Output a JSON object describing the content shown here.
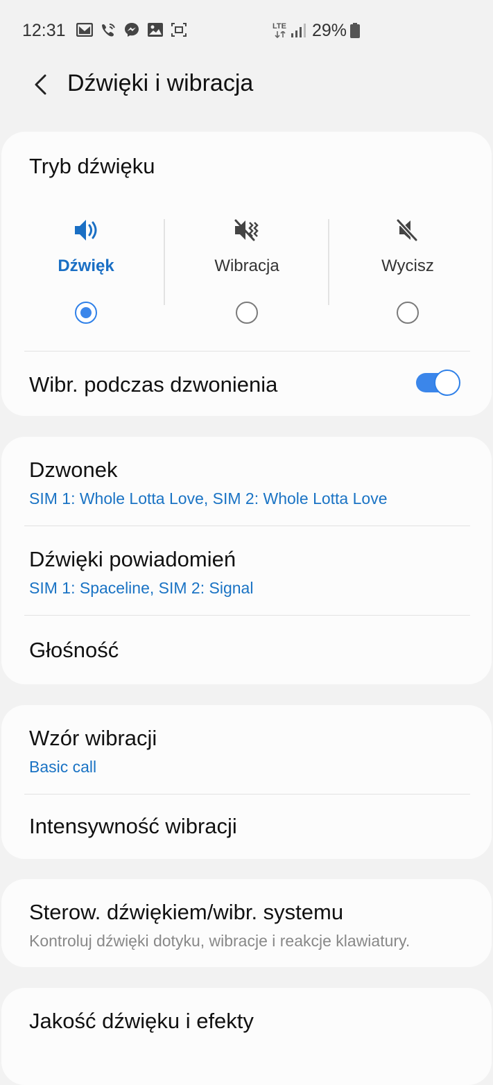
{
  "status_bar": {
    "time": "12:31",
    "network": "LTE",
    "battery_percent": "29%",
    "icons": [
      "gmail-icon",
      "wifi-call-icon",
      "messenger-icon",
      "gallery-icon",
      "screenshot-icon",
      "signal-icon",
      "battery-icon"
    ]
  },
  "header": {
    "title": "Dźwięki i wibracja"
  },
  "sound_mode": {
    "title": "Tryb dźwięku",
    "options": [
      {
        "label": "Dźwięk",
        "selected": true
      },
      {
        "label": "Wibracja",
        "selected": false
      },
      {
        "label": "Wycisz",
        "selected": false
      }
    ],
    "vibrate_while_ringing": {
      "label": "Wibr. podczas dzwonienia",
      "on": true
    }
  },
  "ringtones": {
    "ringtone": {
      "title": "Dzwonek",
      "value": "SIM 1: Whole Lotta Love, SIM 2: Whole Lotta Love"
    },
    "notification_sounds": {
      "title": "Dźwięki powiadomień",
      "value": "SIM 1: Spaceline, SIM 2: Signal"
    },
    "volume": {
      "title": "Głośność"
    }
  },
  "vibration": {
    "pattern": {
      "title": "Wzór wibracji",
      "value": "Basic call"
    },
    "intensity": {
      "title": "Intensywność wibracji"
    }
  },
  "system": {
    "title": "Sterow. dźwiękiem/wibr. systemu",
    "subtitle": "Kontroluj dźwięki dotyku, wibracje i reakcje klawiatury."
  },
  "quality": {
    "title": "Jakość dźwięku i efekty"
  },
  "colors": {
    "accent": "#1a73c4",
    "toggle": "#3b86ea",
    "background": "#f2f2f2",
    "card": "#fcfcfc"
  }
}
